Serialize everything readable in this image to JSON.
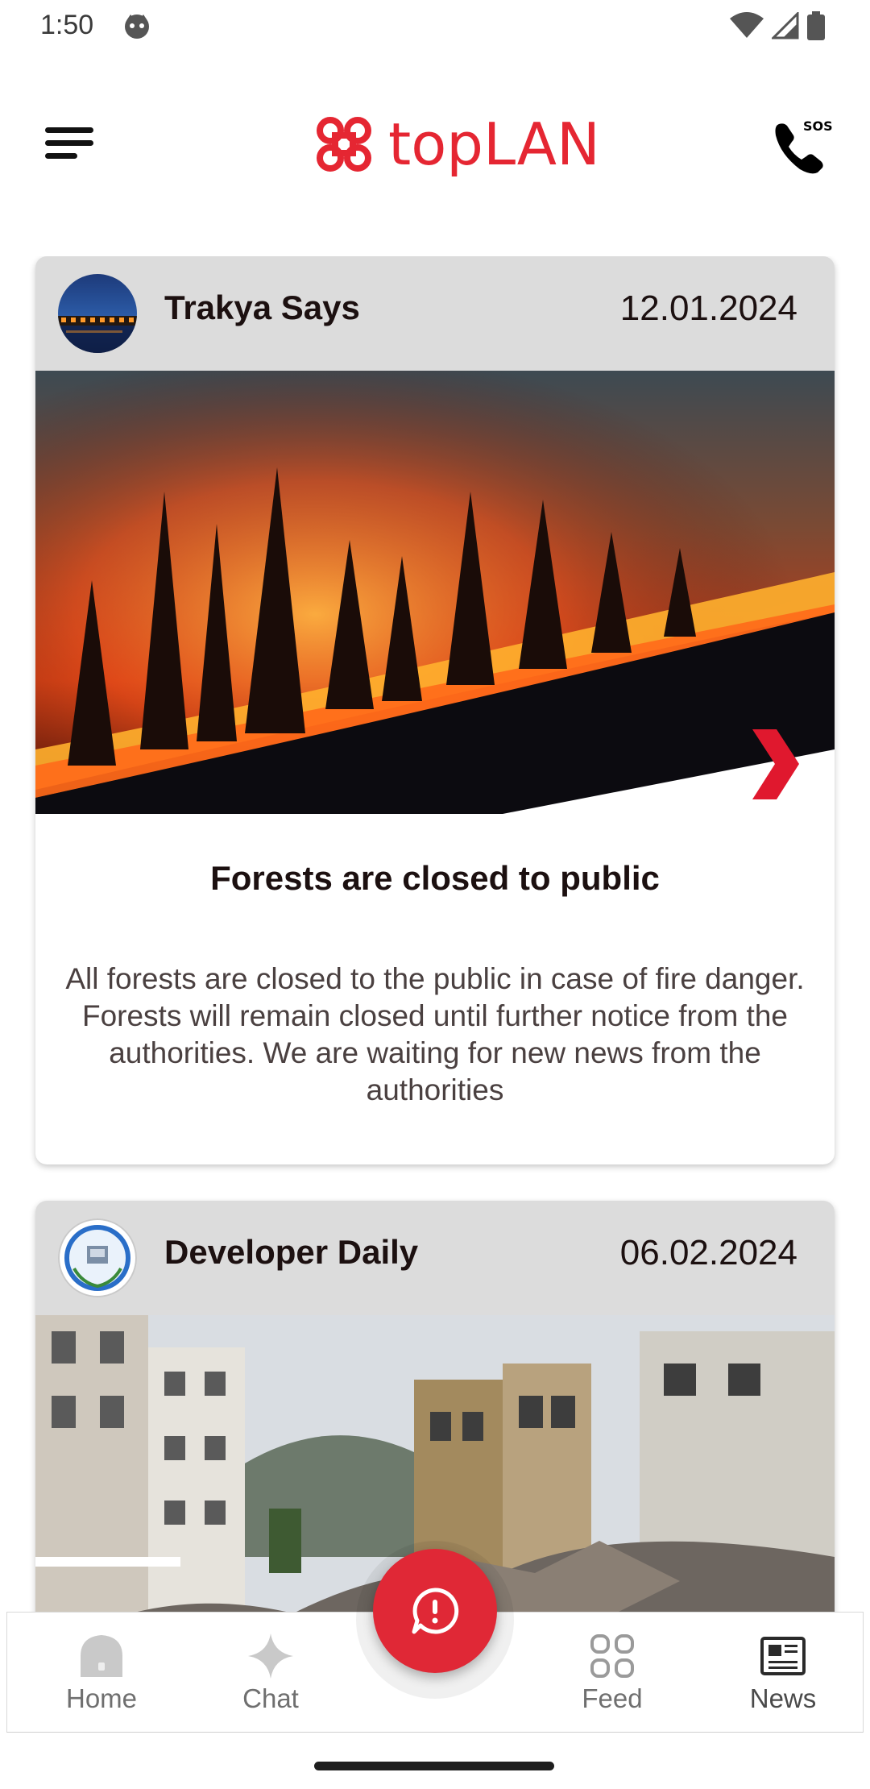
{
  "status_bar": {
    "time": "1:50"
  },
  "header": {
    "logo_text": "topLAN",
    "brand_color": "#e52632"
  },
  "posts": [
    {
      "author": "Trakya Says",
      "date": "12.01.2024",
      "image": "forest-fire-photo",
      "title": "Forests are closed to public",
      "body": "All forests are closed to the public in case of fire danger. Forests will remain closed until further notice from the authorities. We are waiting for new news from the authorities"
    },
    {
      "author": "Developer Daily",
      "date": "06.02.2024",
      "image": "earthquake-damage-photo"
    }
  ],
  "bottom_nav": {
    "items": [
      {
        "label": "Home",
        "icon": "home-icon"
      },
      {
        "label": "Chat",
        "icon": "sparkle-icon"
      },
      {
        "label": "Feed",
        "icon": "grid-icon"
      },
      {
        "label": "News",
        "icon": "newspaper-icon"
      }
    ],
    "fab_icon": "alert-chat-icon",
    "fab_color": "#e02836"
  }
}
